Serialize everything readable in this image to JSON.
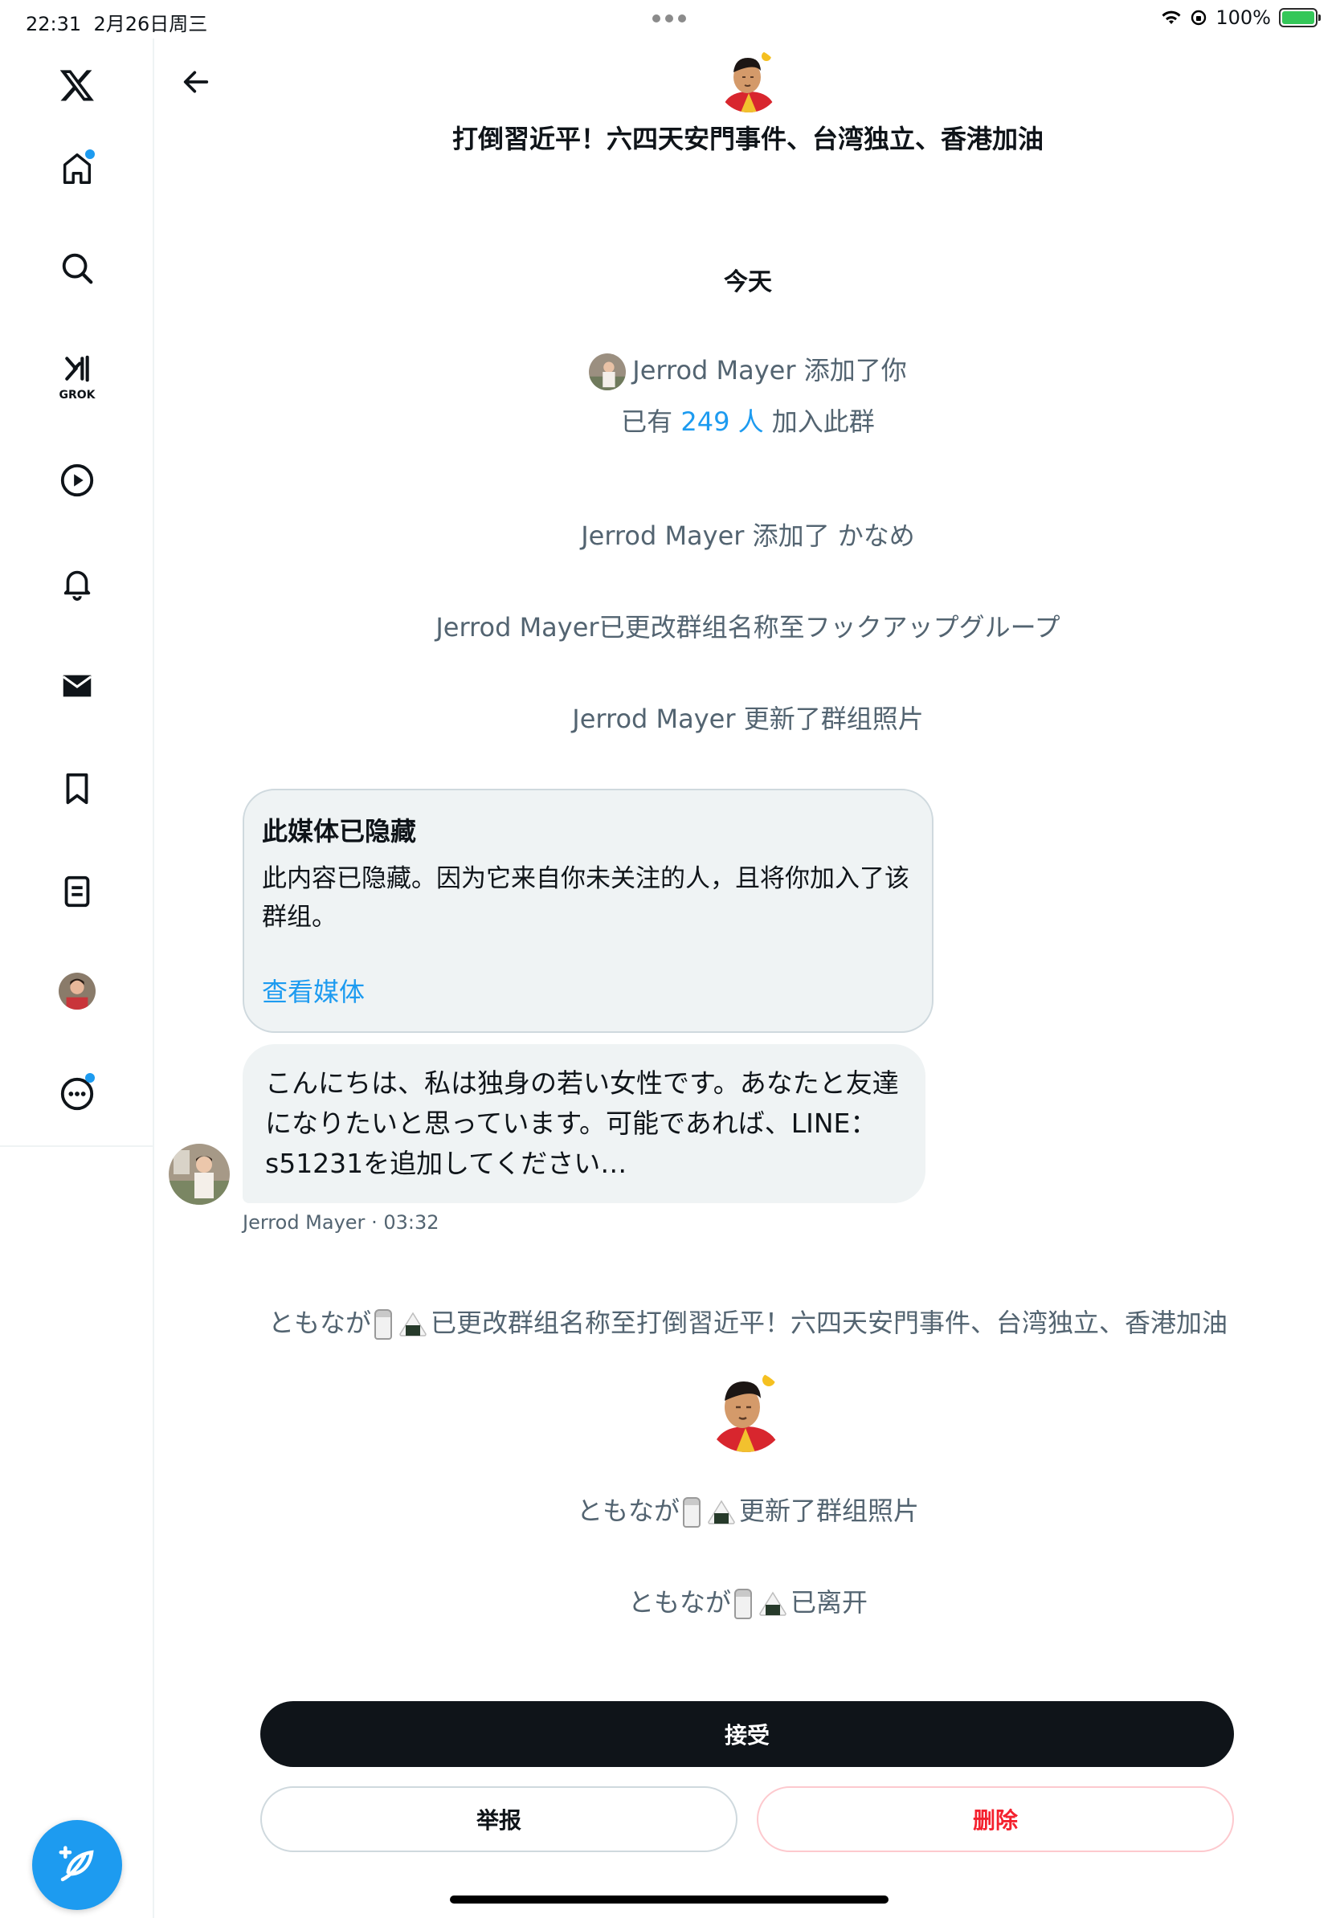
{
  "status_bar": {
    "time": "22:31",
    "date": "2月26日周三",
    "battery": "100%"
  },
  "header": {
    "title": "打倒習近平！六四天安門事件、台湾独立、香港加油"
  },
  "conversation": {
    "date_label": "今天",
    "added_you": "Jerrod Mayer 添加了你",
    "members_prefix": "已有 ",
    "members_count": "249 人",
    "members_suffix": " 加入此群",
    "system_1": "Jerrod Mayer 添加了 かなめ",
    "system_2": "Jerrod Mayer已更改群组名称至フックアップグループ",
    "system_3": "Jerrod Mayer 更新了群组照片",
    "hidden_media": {
      "title": "此媒体已隐藏",
      "body": "此内容已隐藏。因为它来自你未关注的人，且将你加入了该群组。",
      "view_label": "查看媒体"
    },
    "message": {
      "text": "こんにちは、私は独身の若い女性です。あなたと友達になりたいと思っています。可能であれば、LINE：s51231を追加してください…",
      "sender": "Jerrod Mayer",
      "time": "03:32"
    },
    "tomonaga_name": "ともなが",
    "system_4": "已更改群组名称至打倒習近平！六四天安門事件、台湾独立、香港加油",
    "system_5": "更新了群组照片",
    "system_6": "已离开"
  },
  "actions": {
    "accept": "接受",
    "report": "举报",
    "delete": "删除"
  },
  "sidebar": {
    "grok_label": "GROK"
  },
  "colors": {
    "accent": "#1d9bf0",
    "danger": "#f4212e",
    "muted": "#536471"
  }
}
